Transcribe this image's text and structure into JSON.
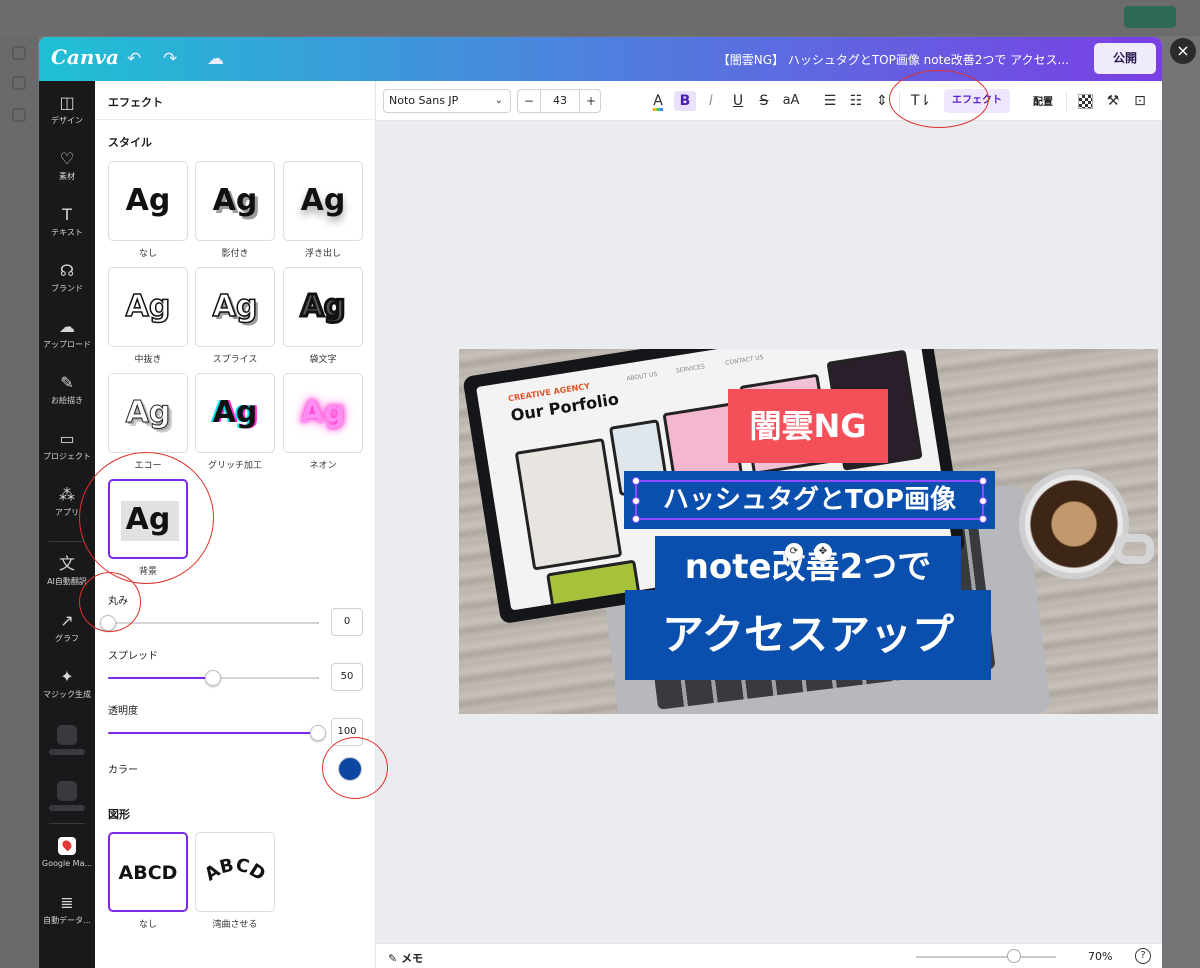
{
  "header": {
    "logo": "Canva",
    "undo_icon": "undo-icon",
    "redo_icon": "redo-icon",
    "cloud_icon": "cloud-saved-icon",
    "doc_title": "【闇雲NG】 ハッシュタグとTOP画像 note改善2つで アクセス...",
    "publish_label": "公開",
    "close_label": "×",
    "gradient": [
      "#1fc0d4",
      "#4a86dd",
      "#7a3fe4"
    ]
  },
  "rail": {
    "items": [
      {
        "label": "デザイン",
        "icon": "◫"
      },
      {
        "label": "素材",
        "icon": "♡"
      },
      {
        "label": "テキスト",
        "icon": "T"
      },
      {
        "label": "ブランド",
        "icon": "☊"
      },
      {
        "label": "アップロード",
        "icon": "☁"
      },
      {
        "label": "お絵描き",
        "icon": "✎"
      },
      {
        "label": "プロジェクト",
        "icon": "▭"
      },
      {
        "label": "アプリ",
        "icon": "⁂"
      },
      {
        "label": "AI自動翻訳",
        "icon": "文"
      },
      {
        "label": "グラフ",
        "icon": "↗"
      },
      {
        "label": "マジック生成",
        "icon": "✦"
      },
      {
        "label": "Google Ma...",
        "icon": ""
      },
      {
        "label": "自動データ...",
        "icon": "≣"
      }
    ]
  },
  "panel": {
    "title": "エフェクト",
    "style_section": "スタイル",
    "styles": [
      "なし",
      "影付き",
      "浮き出し",
      "中抜き",
      "スプライス",
      "袋文字",
      "エコー",
      "グリッチ加工",
      "ネオン",
      "背景"
    ],
    "sample_text": "Ag",
    "selected_style": "背景",
    "roundness": {
      "label": "丸み",
      "value": "0",
      "fraction": 0.0
    },
    "spread": {
      "label": "スプレッド",
      "value": "50",
      "fraction": 0.5
    },
    "transparency": {
      "label": "透明度",
      "value": "100",
      "fraction": 1.0
    },
    "color_label": "カラー",
    "color_value": "#0d47a1",
    "shape_section": "図形",
    "shape_sample": "ABCD",
    "shapes": [
      "なし",
      "湾曲させる"
    ],
    "selected_shape": "なし",
    "accent": "#7d2ae8"
  },
  "toolbar": {
    "font": "Noto Sans JP",
    "font_size": "43",
    "minus": "−",
    "plus": "+",
    "effect_label": "エフェクト",
    "arrange_label": "配置"
  },
  "canvas": {
    "mock_brand": "CREATIVE AGENCY",
    "mock_heading": "Our Porfolio",
    "mock_nav": [
      "ABOUT US",
      "SERVICES",
      "CONTACT US"
    ],
    "line1": "闇雲NG",
    "line2": "ハッシュタグとTOP画像",
    "line3": "note改善2つで",
    "line4": "アクセスアップ",
    "line1_bg": "#f4505a",
    "text_bg": "#0b4fae"
  },
  "bottom": {
    "memo_label": "メモ",
    "zoom": "70%",
    "zoom_fraction": 0.7,
    "help": "?"
  },
  "annotations": {
    "color": "#e0302a"
  }
}
